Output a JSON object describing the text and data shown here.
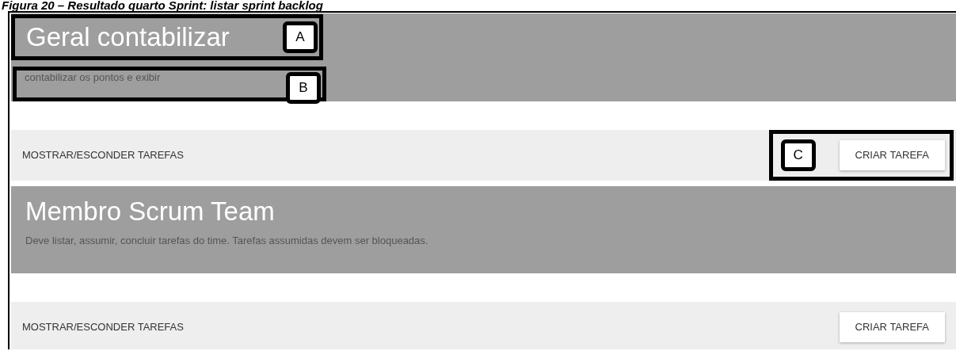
{
  "caption": "Figura 20 – Resultado quarto Sprint: listar sprint backlog",
  "cards": [
    {
      "title": "Geral contabilizar",
      "title_marker": "A",
      "description": "contabilizar os pontos e exibir",
      "description_marker": "B",
      "toggle_label": "MOSTRAR/ESCONDER TAREFAS",
      "button_label": "CRIAR TAREFA",
      "button_marker": "C"
    },
    {
      "title": "Membro Scrum Team",
      "description": "Deve listar, assumir, concluir tarefas do time. Tarefas assumidas devem ser bloqueadas.",
      "toggle_label": "MOSTRAR/ESCONDER TAREFAS",
      "button_label": "CRIAR TAREFA"
    }
  ]
}
